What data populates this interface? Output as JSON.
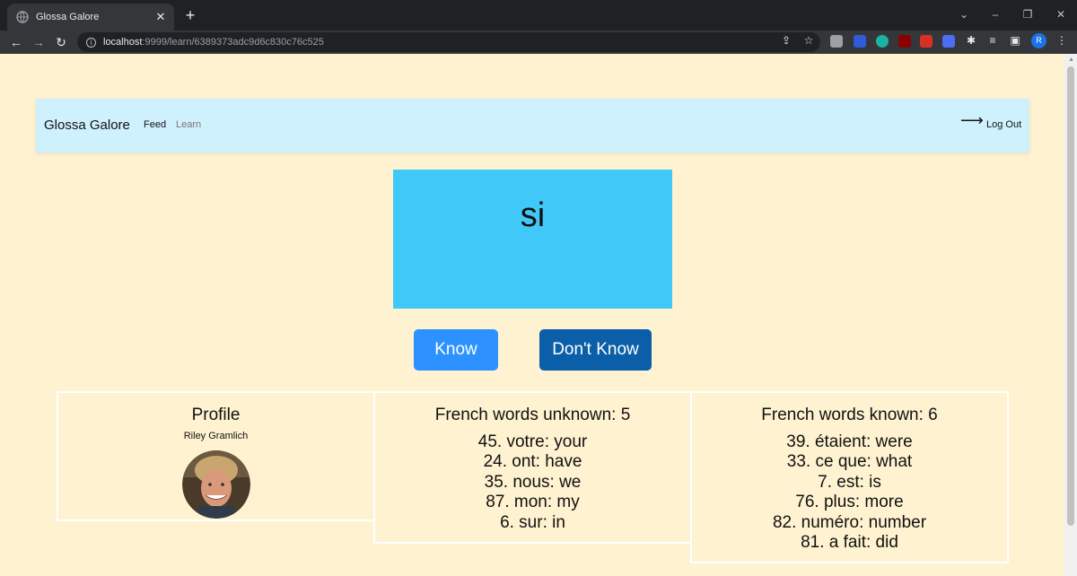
{
  "browser": {
    "tab_title": "Glossa Galore",
    "url_host": "localhost",
    "url_path": ":9999/learn/6389373adc9d6c830c76c525",
    "profile_initial": "R"
  },
  "navbar": {
    "brand": "Glossa Galore",
    "links": [
      "Feed",
      "Learn"
    ],
    "logout": "Log Out"
  },
  "flashcard": {
    "word": "si"
  },
  "actions": {
    "know": "Know",
    "dont_know": "Don't Know"
  },
  "profile": {
    "title": "Profile",
    "name": "Riley Gramlich"
  },
  "unknown_words": {
    "title": "French words unknown: 5",
    "items": [
      "45. votre: your",
      "24. ont: have",
      "35. nous: we",
      "87. mon: my",
      "6. sur: in"
    ]
  },
  "known_words": {
    "title": "French words known: 6",
    "items": [
      "39. étaient: were",
      "33. ce que: what",
      "7. est: is",
      "76. plus: more",
      "82. numéro: number",
      "81. a fait: did"
    ]
  },
  "colors": {
    "page_bg": "#fff2d0",
    "navbar_bg": "#cff1fd",
    "flashcard_bg": "#40c8f8",
    "know_button": "#2d92ff",
    "dont_know_button": "#0b5ea8"
  }
}
